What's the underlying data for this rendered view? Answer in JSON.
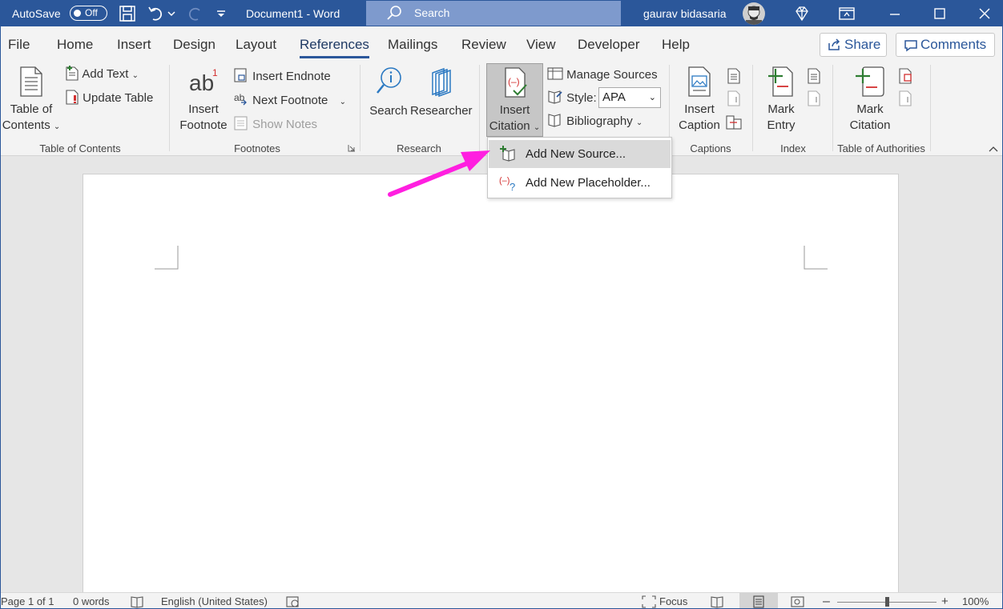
{
  "titlebar": {
    "autosave_label": "AutoSave",
    "autosave_state": "Off",
    "document_title": "Document1  -  Word",
    "search_placeholder": "Search",
    "user_name": "gaurav bidasaria"
  },
  "tabs": {
    "file": "File",
    "home": "Home",
    "insert": "Insert",
    "design": "Design",
    "layout": "Layout",
    "references": "References",
    "mailings": "Mailings",
    "review": "Review",
    "view": "View",
    "developer": "Developer",
    "help": "Help",
    "share": "Share",
    "comments": "Comments"
  },
  "ribbon": {
    "toc": {
      "table_of_contents_line1": "Table of",
      "table_of_contents_line2": "Contents",
      "add_text": "Add Text",
      "update_table": "Update Table",
      "group_label": "Table of Contents"
    },
    "footnotes": {
      "insert_footnote_line1": "Insert",
      "insert_footnote_line2": "Footnote",
      "insert_endnote": "Insert Endnote",
      "next_footnote": "Next Footnote",
      "show_notes": "Show Notes",
      "group_label": "Footnotes"
    },
    "research": {
      "search": "Search",
      "researcher": "Researcher",
      "group_label": "Research"
    },
    "citations": {
      "insert_citation_line1": "Insert",
      "insert_citation_line2": "Citation",
      "manage_sources": "Manage Sources",
      "style_label": "Style:",
      "style_value": "APA",
      "bibliography": "Bibliography"
    },
    "captions": {
      "insert_caption_line1": "Insert",
      "insert_caption_line2": "Caption",
      "group_label": "Captions"
    },
    "index": {
      "mark_entry_line1": "Mark",
      "mark_entry_line2": "Entry",
      "group_label": "Index"
    },
    "authorities": {
      "mark_citation_line1": "Mark",
      "mark_citation_line2": "Citation",
      "group_label": "Table of Authorities"
    }
  },
  "menu": {
    "add_new_source": "Add New Source...",
    "add_new_placeholder": "Add New Placeholder..."
  },
  "status": {
    "page": "Page 1 of 1",
    "words": "0 words",
    "language": "English (United States)",
    "focus": "Focus",
    "zoom": "100%"
  },
  "colors": {
    "brand": "#2b579a",
    "annotation_arrow": "#ff1fe0"
  }
}
